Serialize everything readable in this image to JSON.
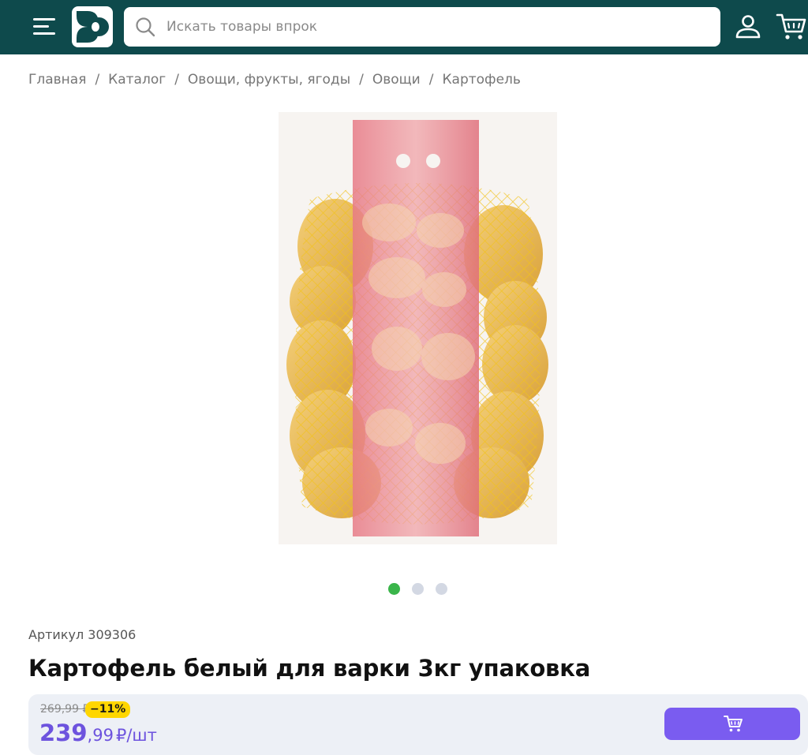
{
  "header": {
    "menu_icon": "hamburger-menu-icon",
    "logo_icon": "store-logo-icon",
    "search": {
      "placeholder": "Искать товары впрок",
      "value": ""
    },
    "user_icon": "user-icon",
    "cart_icon": "cart-icon"
  },
  "breadcrumb": {
    "items": [
      "Главная",
      "Каталог",
      "Овощи, фрукты, ягоды",
      "Овощи",
      "Картофель"
    ],
    "separator": "/"
  },
  "product": {
    "image_icon": "product-photo-potato-bag",
    "gallery": {
      "count": 3,
      "active_index": 0
    },
    "sku_label": "Артикул 309306",
    "title": "Картофель белый для варки 3кг упаковка",
    "price": {
      "old": "269,99 ₽",
      "discount": "−11%",
      "integer": "239",
      "fraction": ",99",
      "unit": "₽/шт"
    },
    "add_to_cart_icon": "cart-icon"
  },
  "colors": {
    "header_bg": "#0e4a4c",
    "accent_purple": "#7a5cf0",
    "price_purple": "#6d53de",
    "discount_yellow": "#ffd600",
    "dot_active_green": "#3ab54a",
    "panel_bg": "#edf0f6"
  }
}
